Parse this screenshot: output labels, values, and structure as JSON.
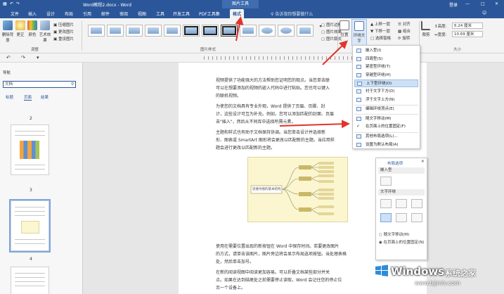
{
  "titlebar": {
    "title": "Word教程2.docx - Word",
    "context_group": "图片工具",
    "user": "登录"
  },
  "tabs": [
    "文件",
    "插入",
    "设计",
    "布局",
    "引用",
    "邮件",
    "审阅",
    "视图",
    "工具",
    "开发工具",
    "PDF工具集",
    "格式"
  ],
  "active_tab": "格式",
  "tellme_placeholder": "告诉我你想要做什么",
  "ribbon": {
    "adjust": {
      "buttons": [
        "删除背景",
        "更正",
        "颜色",
        "艺术效果"
      ],
      "small": [
        "压缩图片",
        "更改图片",
        "重设图片"
      ],
      "label": "调整"
    },
    "styles": {
      "label": "图片样式",
      "small": [
        "图片边框",
        "图片效果",
        "图片版式"
      ]
    },
    "arrange": {
      "position": "位置",
      "wrap": "环绕文字",
      "small": [
        "上移一层",
        "下移一层",
        "选择窗格"
      ],
      "small2": [
        "对齐",
        "组合",
        "旋转"
      ]
    },
    "size": {
      "label": "大小",
      "crop": "裁剪",
      "height_label": "高度:",
      "height": "6.24 厘米",
      "width_label": "宽度:",
      "width": "10.69 厘米"
    }
  },
  "nav": {
    "title": "导航",
    "search": "文档",
    "tabs": [
      "标题",
      "页面",
      "结果"
    ],
    "pages": [
      "2",
      "3",
      "4",
      "5"
    ]
  },
  "document": {
    "lines": [
      "视频提供了功能强大的方法帮助您证明您的观点。当您单击联",
      "可以在想要添加的视频的嵌入代码中进行粘贴。您也可以键入",
      "的联机视频。",
      "为使您的文档具有专业外观，Word 提供了页眉、页脚、封",
      "计，这些设计可互为补充。例如，您可以添加匹配的封面、页眉",
      "击\"插入\"，然后从不同库中选择所需元素。",
      "主题和样式也有助于文档保持协调。当您单击设计并选择新",
      "形、图表或 SmartArt 图形将会更改以匹配新的主题。当应用样",
      "题会进行更改以匹配新的主题。",
      "使用在需要位置出现的新按钮在 Word 中保存时间。若要更改图片",
      "的方式，请单击该图片，图片旁边将会显示布局选项按钮。当处理表格",
      "处，然后单击加号。",
      "在新的阅读视图中阅读更加容易。可以折叠文档某些部分并关",
      "点。如果在达到结尾处之前需要停止读取，Word 会记住您的停止位",
      "另一个设备上。"
    ],
    "mindmap": {
      "center": "思维导图的基本结构"
    }
  },
  "wrap_menu": {
    "items": [
      "嵌入型(I)",
      "四周型(S)",
      "紧密型环绕(T)",
      "穿越型环绕(H)",
      "上下型环绕(O)",
      "衬于文字下方(D)",
      "浮于文字上方(N)",
      "编辑环绕顶点(E)",
      "随文字移动(M)",
      "在页面上的位置固定(F)",
      "其他布局选项(L)...",
      "设置为默认布局(A)"
    ],
    "highlighted": 4,
    "checked": 9
  },
  "layout_options": {
    "title": "布局选项",
    "inline_header": "嵌入型",
    "wrap_header": "文字环绕",
    "radio1": "随文字移动(M)",
    "radio2": "在页面上的位置固定(N)",
    "radio_selected": 2
  },
  "watermark": {
    "brand": "Windows",
    "cn": "系统之家",
    "url": "www.bjjmlv.com"
  },
  "colors": {
    "ribbon_blue": "#2b579a",
    "arrow_red": "#e0342c",
    "highlight": "#cde0f5"
  }
}
